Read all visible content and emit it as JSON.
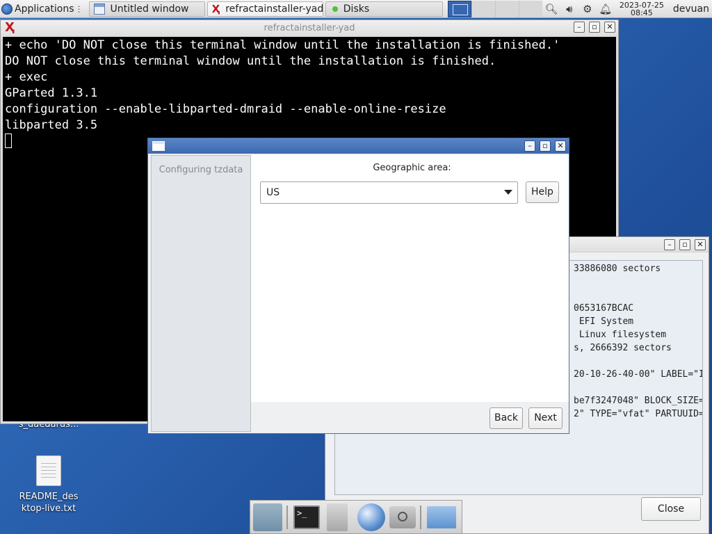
{
  "panel": {
    "applications_label": "Applications",
    "applications_marker": "⋮",
    "tasks": [
      {
        "label": "Untitled window"
      },
      {
        "label": "refractainstaller-yad"
      },
      {
        "label": "Disks"
      }
    ],
    "clock_date": "2023-07-25",
    "clock_time": "08:45",
    "user": "devuan"
  },
  "terminal": {
    "title": "refractainstaller-yad",
    "lines": [
      "+ echo 'DO NOT close this terminal window until the installation is finished.'",
      "DO NOT close this terminal window until the installation is finished.",
      "+ exec",
      "GParted 1.3.1",
      "configuration --enable-libparted-dmraid --enable-online-resize",
      "libparted 3.5"
    ]
  },
  "disks_dialog": {
    "lines": [
      "33886080 sectors",
      "",
      "",
      "0653167BCAC",
      " EFI System",
      " Linux filesystem",
      "s, 2666392 sectors",
      "",
      "20-10-26-40-00\" LABEL=\"I",
      "",
      "be7f3247048\" BLOCK_SIZE=",
      "2\" TYPE=\"vfat\" PARTUUID="
    ],
    "close_label": "Close"
  },
  "installer": {
    "step_label": "Configuring tzdata",
    "geo_label": "Geographic area:",
    "selected_area": "US",
    "help_label": "Help",
    "back_label": "Back",
    "next_label": "Next"
  },
  "desktop": {
    "icon_partial_label": "s_daedarus...",
    "readme_label_line1": "README_des",
    "readme_label_line2": "ktop-live.txt"
  }
}
